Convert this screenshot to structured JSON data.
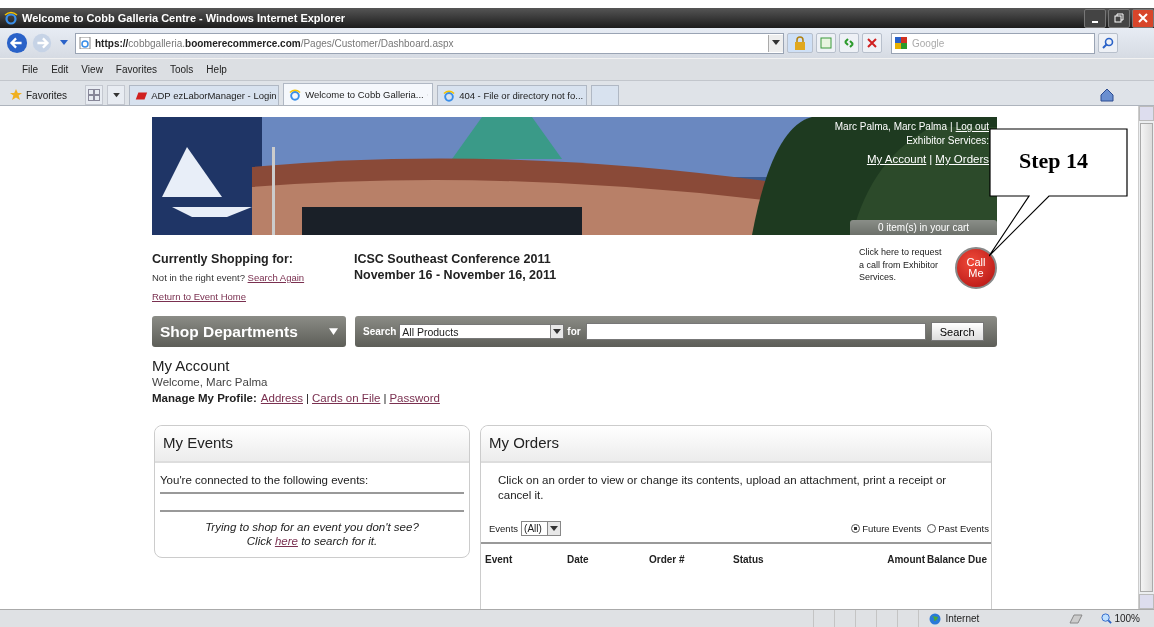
{
  "window": {
    "title": "Welcome to Cobb Galleria Centre - Windows Internet Explorer"
  },
  "address_bar": {
    "url": "**https://**cobbgalleria.**boomerecommerce.com**/Pages/Customer/Dashboard.aspx"
  },
  "search_box": {
    "placeholder": "Google"
  },
  "menu": [
    "File",
    "Edit",
    "View",
    "Favorites",
    "Tools",
    "Help"
  ],
  "favorites_bar": {
    "label": "Favorites"
  },
  "tabs": [
    {
      "label": "ADP ezLaborManager - Login",
      "selected": false
    },
    {
      "label": "Welcome to Cobb Galleria...",
      "selected": true
    },
    {
      "label": "404 - File or directory not fo...",
      "selected": false
    }
  ],
  "header": {
    "user": "Marc Palma, Marc Palma",
    "separator": "|",
    "logout": "Log out",
    "services": "Exhibitor Services:",
    "links": [
      "My Account",
      "My Orders"
    ],
    "cart": "0 item(s) in your cart"
  },
  "shopping": {
    "label": "Currently Shopping for:",
    "not_right": "Not in the right event?",
    "search_again": "Search Again",
    "return": "Return to Event Home",
    "event_name": "ICSC Southeast Conference 2011",
    "event_dates": "November 16 - November 16, 2011"
  },
  "call_me": {
    "text": "Click here to request a call from Exhibitor Services.",
    "button": "Call Me"
  },
  "departments": {
    "label": "Shop Departments"
  },
  "search": {
    "label": "Search",
    "category": "All Products",
    "for": "for",
    "button": "Search"
  },
  "account": {
    "title": "My Account",
    "welcome": "Welcome, Marc Palma",
    "profile_label": "Manage My Profile:",
    "links": [
      "Address",
      "Cards on File",
      "Password"
    ],
    "separator": "|"
  },
  "events_panel": {
    "title": "My Events",
    "intro": "You're connected to the following events:",
    "hint": "Trying to shop for an event you don't see?",
    "click": "Click",
    "here": "here",
    "after": "to search for it."
  },
  "orders_panel": {
    "title": "My Orders",
    "intro": "Click on an order to view or change its contents, upload an attachment, print a receipt or cancel it.",
    "filter_label": "Events",
    "filter_value": "(All)",
    "radios": [
      {
        "label": "Future Events",
        "selected": true
      },
      {
        "label": "Past Events",
        "selected": false
      }
    ],
    "columns": [
      "Event",
      "Date",
      "Order #",
      "Status",
      "Amount",
      "Balance Due"
    ]
  },
  "status_bar": {
    "zone": "Internet",
    "zoom": "100%"
  },
  "callout": {
    "text": "Step 14"
  }
}
